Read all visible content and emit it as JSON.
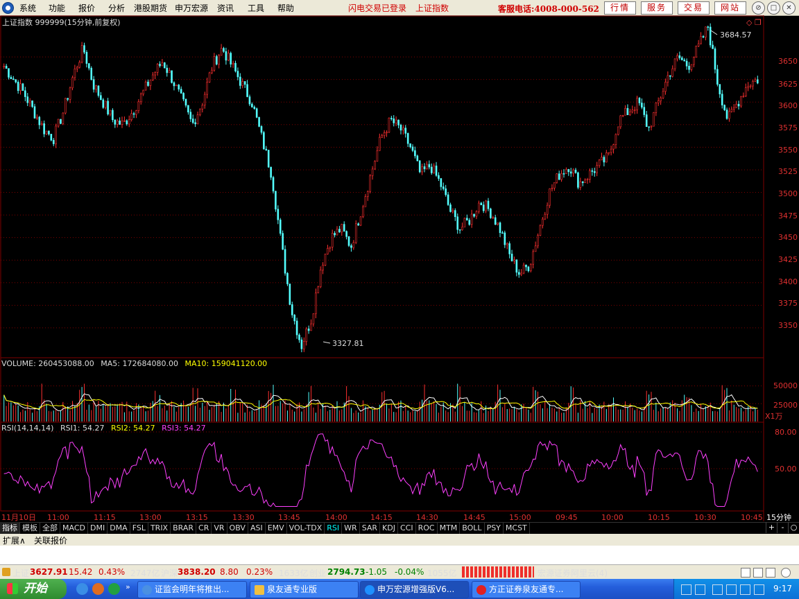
{
  "menu": [
    "系统",
    "功能",
    "报价",
    "分析",
    "港股期货",
    "申万宏源",
    "资讯",
    "工具",
    "帮助"
  ],
  "status_login": "闪电交易已登录",
  "status_index": "上证指数",
  "hotline": "客服电话:4008-000-562",
  "top_buttons": [
    "行情",
    "服务",
    "交易",
    "网站"
  ],
  "window_buttons": [
    "⊘",
    "□",
    "✕"
  ],
  "chart": {
    "title": "上证指数 999999(15分钟,前复权)",
    "price_ticks": [
      "3650",
      "3625",
      "3600",
      "3575",
      "3550",
      "3525",
      "3500",
      "3475",
      "3450",
      "3425",
      "3400",
      "3375",
      "3350"
    ],
    "high_label": "3684.57",
    "low_label": "3327.81",
    "volume_header": {
      "label": "VOLUME:",
      "value": "260453088.00",
      "ma5_label": "MA5:",
      "ma5": "172684080.00",
      "ma10_label": "MA10:",
      "ma10": "159041120.00"
    },
    "volume_ticks": [
      "50000",
      "25000"
    ],
    "volume_unit": "X1万",
    "rsi_header": {
      "label": "RSI(14,14,14)",
      "rsi1_label": "RSI1:",
      "rsi1": "54.27",
      "rsi2_label": "RSI2:",
      "rsi2": "54.27",
      "rsi3_label": "RSI3:",
      "rsi3": "54.27"
    },
    "rsi_ticks": [
      "80.00",
      "50.00"
    ],
    "time_labels": [
      "11月10日",
      "11:00",
      "11:15",
      "13:00",
      "13:15",
      "13:30",
      "13:45",
      "14:00",
      "14:15",
      "14:30",
      "14:45",
      "15:00",
      "09:45",
      "10:00",
      "10:15",
      "10:30",
      "10:45"
    ],
    "period": "15分钟",
    "colors": {
      "up": "#ff3030",
      "down": "#54ffff",
      "ma5": "#ffffff",
      "ma10": "#ffff00",
      "rsi": "#ff40ff",
      "grid": "#800000"
    }
  },
  "chart_data": {
    "type": "candlestick",
    "interval": "15min",
    "ylim": [
      3320,
      3690
    ],
    "high": 3684.57,
    "low": 3327.81,
    "close_path": [
      3640,
      3625,
      3610,
      3590,
      3570,
      3560,
      3590,
      3630,
      3660,
      3620,
      3600,
      3580,
      3575,
      3590,
      3610,
      3630,
      3645,
      3625,
      3600,
      3575,
      3600,
      3640,
      3660,
      3640,
      3620,
      3600,
      3560,
      3520,
      3440,
      3370,
      3330,
      3360,
      3420,
      3450,
      3460,
      3440,
      3480,
      3520,
      3560,
      3580,
      3570,
      3550,
      3520,
      3530,
      3510,
      3480,
      3460,
      3470,
      3490,
      3480,
      3460,
      3430,
      3410,
      3420,
      3460,
      3500,
      3520,
      3530,
      3510,
      3520,
      3530,
      3540,
      3580,
      3590,
      3600,
      3570,
      3600,
      3630,
      3650,
      3640,
      3660,
      3684,
      3620,
      3580,
      3600,
      3620,
      3625
    ],
    "volume_ylim": [
      0,
      70000
    ],
    "rsi_ylim": [
      20,
      90
    ]
  },
  "indicator_tabs": [
    "指标",
    "模板",
    "全部",
    "MACD",
    "DMI",
    "DMA",
    "FSL",
    "TRIX",
    "BRAR",
    "CR",
    "VR",
    "OBV",
    "ASI",
    "EMV",
    "VOL-TDX",
    "RSI",
    "WR",
    "SAR",
    "KDJ",
    "CCI",
    "ROC",
    "MTM",
    "BOLL",
    "PSY",
    "MCST"
  ],
  "right_controls": [
    "+",
    "-",
    "○"
  ],
  "ext_tabs": [
    "扩展∧",
    "关联报价"
  ],
  "ticker": {
    "sh_label": "上证",
    "sh_value": "3627.91",
    "sh_chg": "15.42",
    "sh_pct": "0.43%",
    "sh_amt": "2747亿",
    "hs_label": "沪深",
    "hs_value": "3838.20",
    "hs_chg": "8.80",
    "hs_pct": "0.23%",
    "hs_amt": "1633亿",
    "cy_label": "创业",
    "cy_value": "2794.73",
    "cy_chg": "-1.05",
    "cy_pct": "-0.04%",
    "cy_amt": "1055亿",
    "broker": "宏源证券阿里云(4)"
  },
  "taskbar": {
    "start": "开始",
    "tasks": [
      "证监会明年将推出...",
      "泉友通专业版",
      "申万宏源增强版V6...",
      "方正证券泉友通专..."
    ],
    "clock": "9:17"
  }
}
